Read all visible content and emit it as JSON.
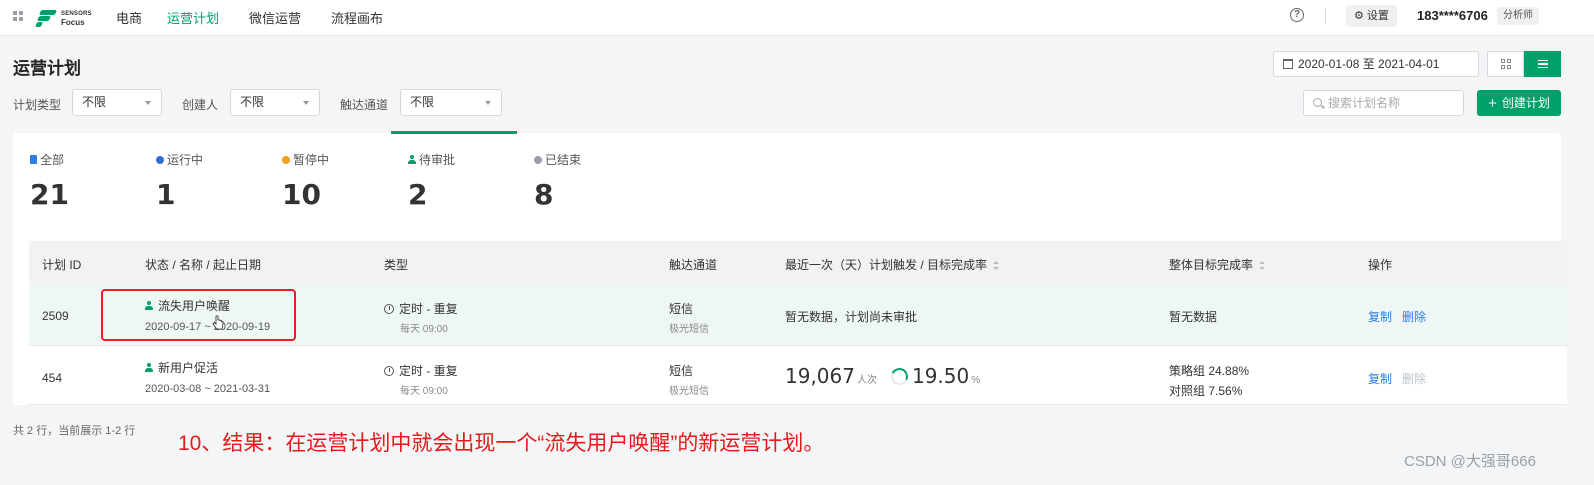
{
  "nav": {
    "logo_line1": "SENSORS",
    "logo_line2": "Focus",
    "items": [
      "电商",
      "运营计划",
      "微信运营",
      "流程画布"
    ],
    "active_index": 1,
    "help": "?",
    "settings_label": "设置",
    "user_name": "183****6706",
    "user_role": "分析师"
  },
  "header": {
    "title": "运营计划",
    "date_range": "2020-01-08 至 2021-04-01"
  },
  "filters": {
    "plan_type_label": "计划类型",
    "plan_type_value": "不限",
    "creator_label": "创建人",
    "creator_value": "不限",
    "channel_label": "触达通道",
    "channel_value": "不限",
    "search_placeholder": "搜索计划名称",
    "create_label": "创建计划"
  },
  "stats": [
    {
      "label": "全部",
      "count": "21",
      "icon": "clipboard-icon",
      "color": "#2b7de9"
    },
    {
      "label": "运行中",
      "count": "1",
      "icon": "check-circle-icon",
      "color": "#2b6fd6"
    },
    {
      "label": "暂停中",
      "count": "10",
      "icon": "pause-circle-icon",
      "color": "#f0a020"
    },
    {
      "label": "待审批",
      "count": "2",
      "icon": "person-icon",
      "color": "#00a06a"
    },
    {
      "label": "已结束",
      "count": "8",
      "icon": "minus-circle-icon",
      "color": "#9aa0a6"
    }
  ],
  "table": {
    "headers": {
      "id": "计划 ID",
      "status_name_dates": "状态 / 名称 / 起止日期",
      "type": "类型",
      "channel": "触达通道",
      "last_trigger": "最近一次（天）计划触发 / 目标完成率",
      "overall": "整体目标完成率",
      "actions": "操作"
    },
    "rows": [
      {
        "id": "2509",
        "name": "流失用户唤醒",
        "dates": "2020-09-17 ~ 2020-09-19",
        "type": "定时 - 重复",
        "type_sub": "每天 09:00",
        "channel": "短信",
        "channel_sub": "极光短信",
        "last_trigger_text": "暂无数据，计划尚未审批",
        "overall_text": "暂无数据",
        "action_copy": "复制",
        "action_delete": "删除"
      },
      {
        "id": "454",
        "name": "新用户促活",
        "dates": "2020-03-08 ~ 2021-03-31",
        "type": "定时 - 重复",
        "type_sub": "每天 09:00",
        "channel": "短信",
        "channel_sub": "极光短信",
        "trigger_count": "19,067",
        "trigger_unit": "人次",
        "rate": "19.50",
        "rate_unit": "%",
        "overall_line1": "策略组 24.88%",
        "overall_line2": "对照组 7.56%",
        "action_copy": "复制",
        "action_delete": "删除"
      }
    ]
  },
  "footer": {
    "count_text": "共 2 行，当前展示 1-2 行"
  },
  "annotation": "10、结果：在运营计划中就会出现一个“流失用户唤醒”的新运营计划。",
  "watermark": "CSDN @大强哥666",
  "colors": {
    "brand": "#00a06a",
    "link": "#2b7de9",
    "annotation": "#e31b1b"
  }
}
